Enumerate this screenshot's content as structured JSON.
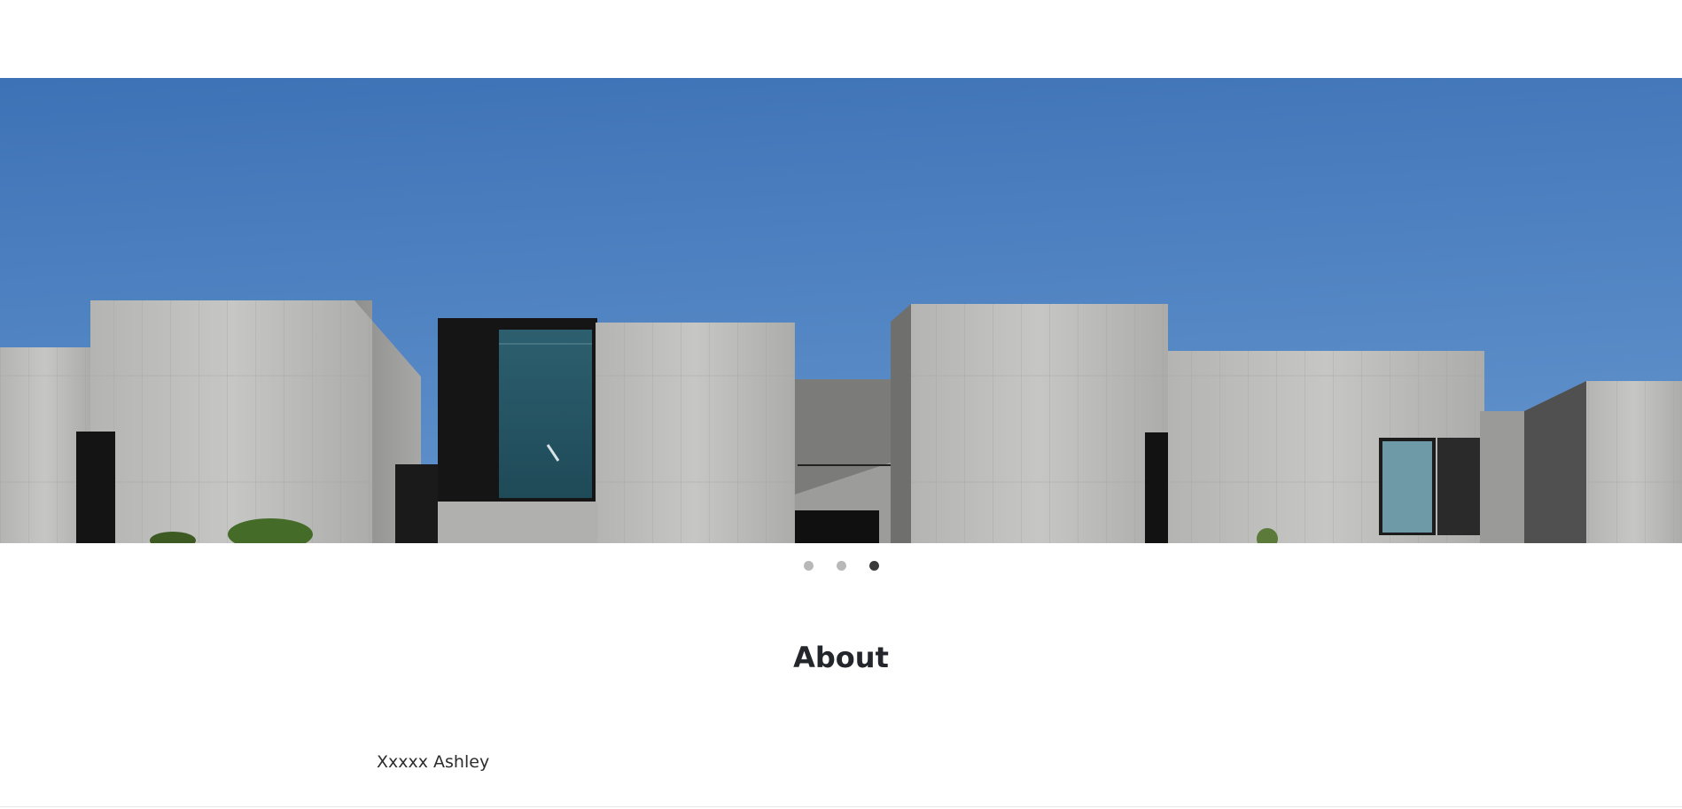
{
  "carousel": {
    "image_alt": "Concrete building against a blue sky",
    "slides": [
      {
        "active": false
      },
      {
        "active": false
      },
      {
        "active": true
      }
    ],
    "colors": {
      "sky_top": "#3f75b8",
      "sky_bottom": "#5d8ecb",
      "concrete": "#b8b8b6",
      "window": "#2f5c6b"
    }
  },
  "about": {
    "title": "About",
    "author": "Xxxxx Ashley"
  }
}
